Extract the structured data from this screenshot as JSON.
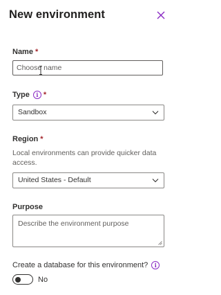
{
  "panel": {
    "title": "New environment",
    "close_icon": "close-icon"
  },
  "name": {
    "label": "Name",
    "required_mark": "*",
    "placeholder": "Choose name"
  },
  "type": {
    "label": "Type",
    "info_glyph": "i",
    "required_mark": "*",
    "selected": "Sandbox"
  },
  "region": {
    "label": "Region",
    "required_mark": "*",
    "help_text": "Local environments can provide quicker data access.",
    "selected": "United States - Default"
  },
  "purpose": {
    "label": "Purpose",
    "placeholder": "Describe the environment purpose"
  },
  "database": {
    "label": "Create a database for this environment?",
    "info_glyph": "i",
    "toggle_text": "No",
    "toggle_on": false
  },
  "colors": {
    "accent": "#8a2bc4",
    "required": "#a4262c"
  }
}
